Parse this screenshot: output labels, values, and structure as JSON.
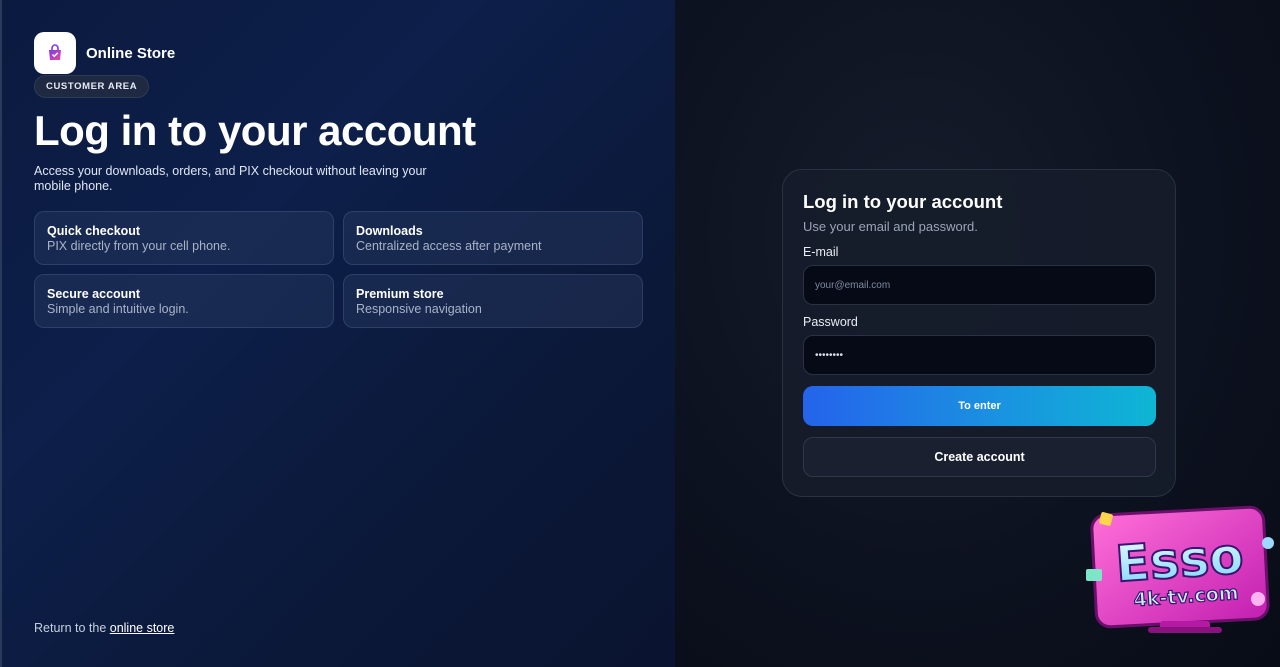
{
  "brand": {
    "name": "Online Store",
    "icon": "shopping-bag-icon"
  },
  "badge": "CUSTOMER AREA",
  "hero": {
    "title": "Log in to your account",
    "subtitle": "Access your downloads, orders, and PIX checkout without leaving your mobile phone."
  },
  "features": [
    {
      "title": "Quick checkout",
      "desc": "PIX directly from your cell phone."
    },
    {
      "title": "Downloads",
      "desc": "Centralized access after payment"
    },
    {
      "title": "Secure account",
      "desc": "Simple and intuitive login."
    },
    {
      "title": "Premium store",
      "desc": "Responsive navigation"
    }
  ],
  "footer": {
    "prefix": "Return to the",
    "link": "online store"
  },
  "login": {
    "title": "Log in to your account",
    "subtitle": "Use your email and password.",
    "email_label": "E-mail",
    "email_placeholder": "your@email.com",
    "password_label": "Password",
    "password_value": "12345678",
    "submit": "To enter",
    "create": "Create account"
  },
  "watermark": {
    "line1": "Esso",
    "line2": "4k-tv.com"
  },
  "colors": {
    "accent_start": "#2563eb",
    "accent_end": "#0eb6d4",
    "watermark_pink": "#e63ec8"
  }
}
